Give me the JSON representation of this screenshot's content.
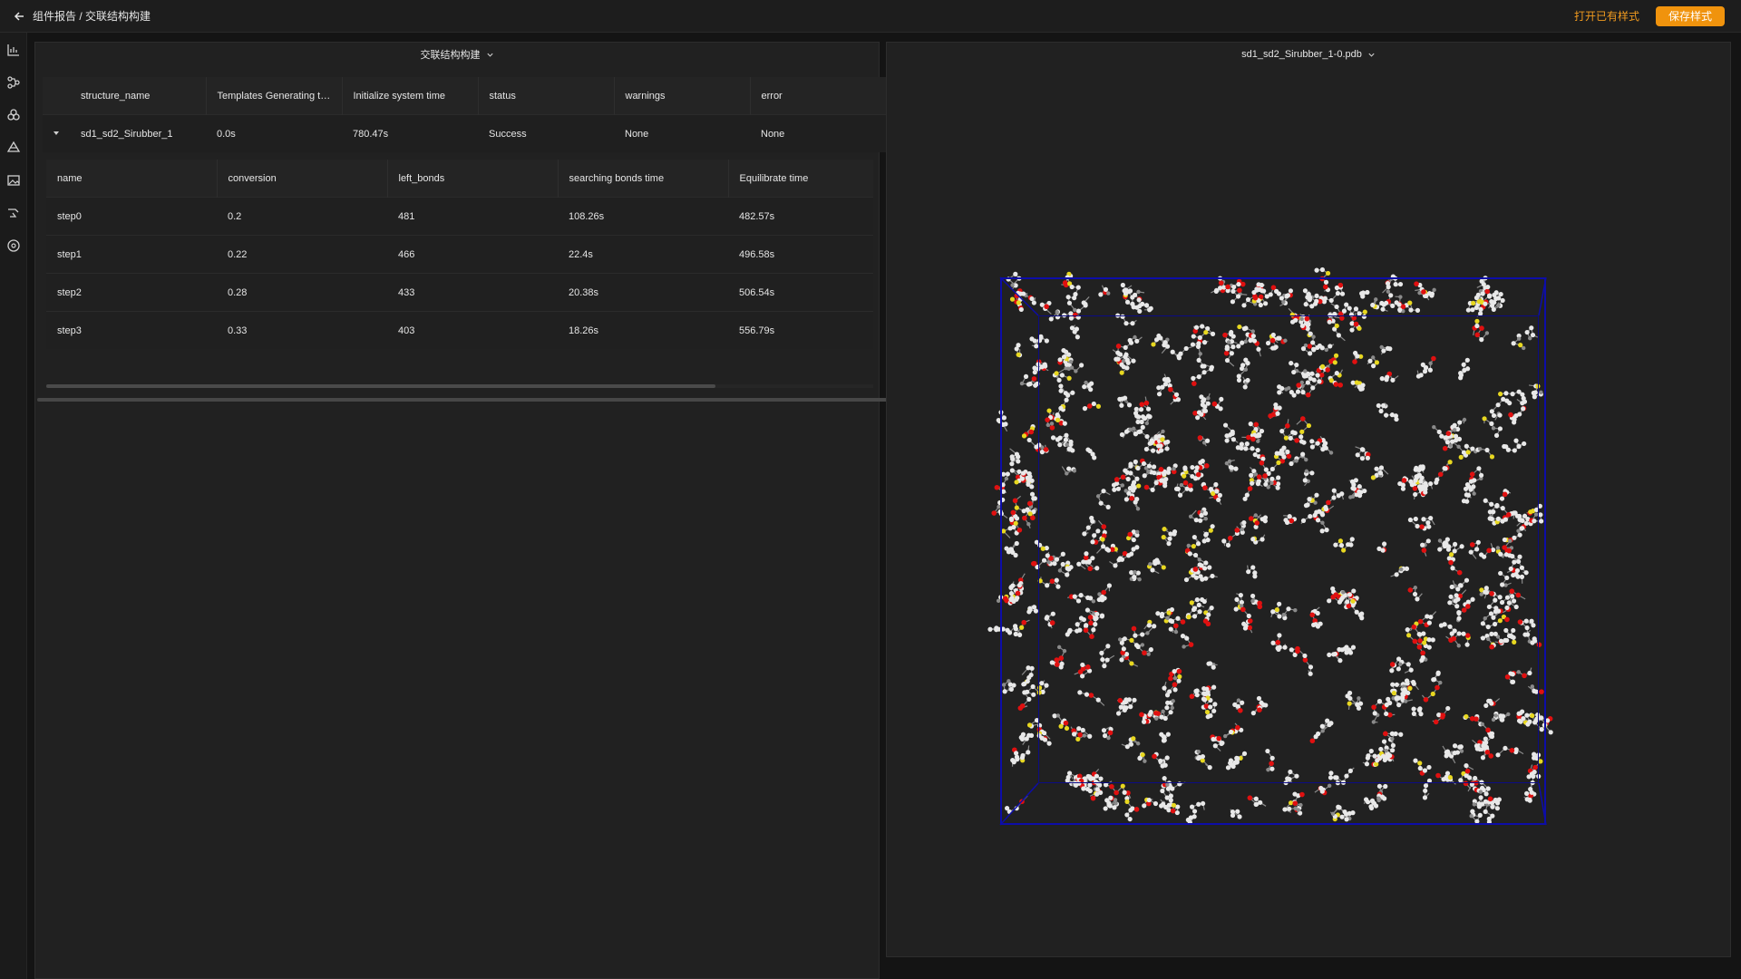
{
  "header": {
    "breadcrumb": "组件报告 / 交联结构构建",
    "open_style_link": "打开已有样式",
    "save_style_button": "保存样式"
  },
  "sidebar": {
    "icons": [
      "chart-icon",
      "flow-icon",
      "molecule-icon",
      "layers-icon",
      "image-icon",
      "route-icon",
      "palette-icon"
    ]
  },
  "left_panel": {
    "title": "交联结构构建",
    "table": {
      "columns": [
        "structure_name",
        "Templates Generating ti...",
        "Initialize system time",
        "status",
        "warnings",
        "error"
      ],
      "rows": [
        {
          "structure_name": "sd1_sd2_Sirubber_1",
          "templates_time": "0.0s",
          "init_time": "780.47s",
          "status": "Success",
          "warnings": "None",
          "error": "None"
        }
      ]
    },
    "sub_table": {
      "columns": [
        "name",
        "conversion",
        "left_bonds",
        "searching bonds time",
        "Equilibrate time"
      ],
      "rows": [
        {
          "name": "step0",
          "conversion": "0.2",
          "left_bonds": "481",
          "search_time": "108.26s",
          "equil_time": "482.57s"
        },
        {
          "name": "step1",
          "conversion": "0.22",
          "left_bonds": "466",
          "search_time": "22.4s",
          "equil_time": "496.58s"
        },
        {
          "name": "step2",
          "conversion": "0.28",
          "left_bonds": "433",
          "search_time": "20.38s",
          "equil_time": "506.54s"
        },
        {
          "name": "step3",
          "conversion": "0.33",
          "left_bonds": "403",
          "search_time": "18.26s",
          "equil_time": "556.79s"
        }
      ]
    }
  },
  "right_panel": {
    "file_select": "sd1_sd2_Sirubber_1-0.pdb"
  },
  "colors": {
    "accent": "#f0930d",
    "box": "#0d0da8",
    "atom_h": "#e8e8e8",
    "atom_o": "#e01010",
    "atom_si": "#e8d820",
    "atom_c": "#8a8a8a"
  }
}
